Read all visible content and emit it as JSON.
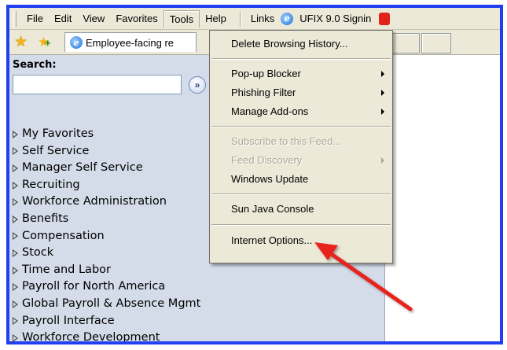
{
  "menubar": {
    "items": [
      "File",
      "Edit",
      "View",
      "Favorites",
      "Tools",
      "Help"
    ],
    "links_label": "Links",
    "link_text": "UFIX 9.0 Signin"
  },
  "toolbar": {
    "tab_title": "Employee-facing re"
  },
  "nav": {
    "search_label": "Search:",
    "search_value": "",
    "items": [
      "My Favorites",
      "Self Service",
      "Manager Self Service",
      "Recruiting",
      "Workforce Administration",
      "Benefits",
      "Compensation",
      "Stock",
      "Time and Labor",
      "Payroll for North America",
      "Global Payroll & Absence Mgmt",
      "Payroll Interface",
      "Workforce Development"
    ]
  },
  "tools_menu": {
    "delete_history": "Delete Browsing History...",
    "popup_blocker": "Pop-up Blocker",
    "phishing_filter": "Phishing Filter",
    "manage_addons": "Manage Add-ons",
    "subscribe_feed": "Subscribe to this Feed...",
    "feed_discovery": "Feed Discovery",
    "windows_update": "Windows Update",
    "sun_java_console": "Sun Java Console",
    "internet_options": "Internet Options..."
  },
  "colors": {
    "frame_border": "#1f3ff0",
    "nav_background": "#d4dbe9",
    "menu_background": "#ece9d8",
    "annotation_arrow": "#e8201a"
  }
}
